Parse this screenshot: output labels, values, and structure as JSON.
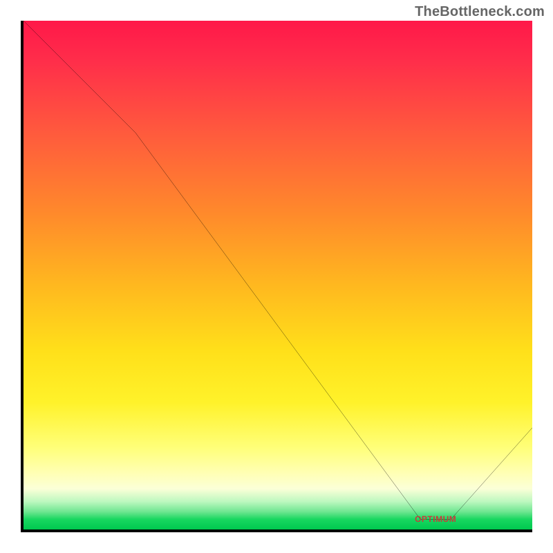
{
  "watermark": "TheBottleneck.com",
  "marker_label": "OPTIMUM",
  "colors": {
    "frame": "#000000",
    "curve": "#000000",
    "marker_text": "#c83b3b"
  },
  "chart_data": {
    "type": "line",
    "title": "",
    "xlabel": "",
    "ylabel": "",
    "xlim": [
      0,
      100
    ],
    "ylim": [
      0,
      100
    ],
    "grid": false,
    "legend": false,
    "series": [
      {
        "name": "bottleneck-curve",
        "x": [
          0,
          22,
          78,
          84,
          100
        ],
        "values": [
          100,
          78,
          2,
          2,
          20
        ]
      }
    ],
    "annotations": [
      {
        "name": "optimum-marker",
        "x": 81,
        "y": 2,
        "text": "OPTIMUM"
      }
    ]
  }
}
